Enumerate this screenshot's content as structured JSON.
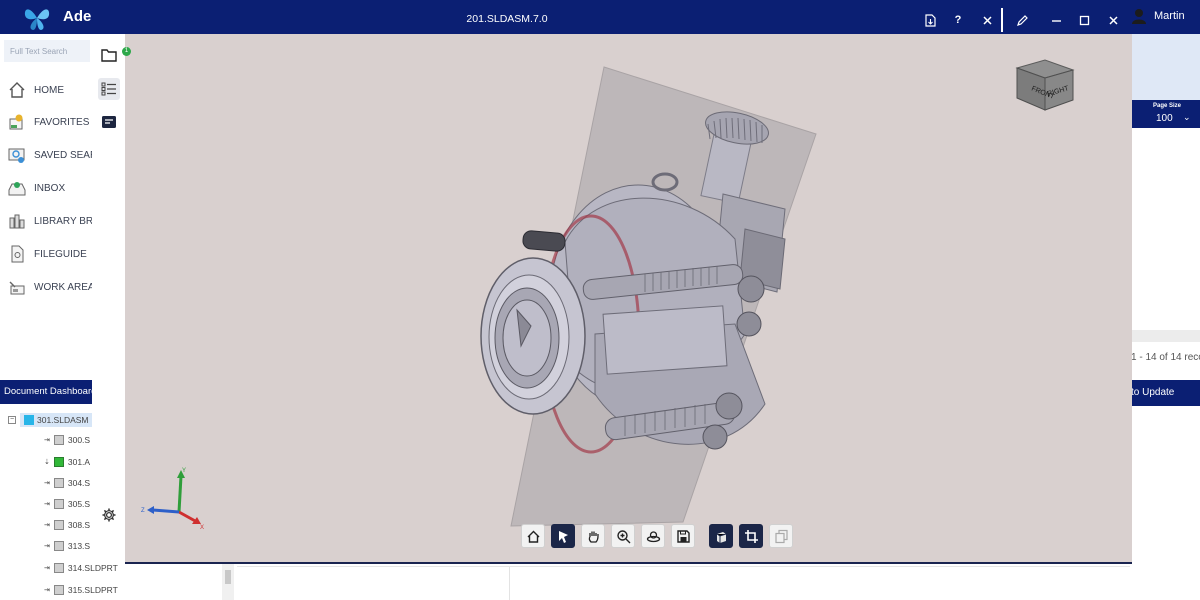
{
  "app": {
    "brand_text": "Ade",
    "user_name": "Martin",
    "search_placeholder": "Full Text Search",
    "nav": [
      {
        "label": "HOME",
        "icon": "home-icon"
      },
      {
        "label": "FAVORITES",
        "icon": "favorites-icon"
      },
      {
        "label": "SAVED SEAR",
        "icon": "saved-search-icon"
      },
      {
        "label": "INBOX",
        "icon": "inbox-icon"
      },
      {
        "label": "LIBRARY BR",
        "icon": "library-icon"
      },
      {
        "label": "FILEGUIDE",
        "icon": "fileguide-icon"
      },
      {
        "label": "WORK AREA",
        "icon": "work-area-icon"
      }
    ],
    "dashboard_label": "Document Dashboard",
    "tree": {
      "root": "301.SLDASM",
      "children": [
        "300.S",
        "301.A",
        "304.S",
        "305.S",
        "308.S",
        "313.S",
        "314.SLDPRT",
        "315.SLDPRT"
      ]
    },
    "right": {
      "page_size_label": "Page Size",
      "page_size_value": "100",
      "records_text": "1 - 14 of 14 reco",
      "update_text": "to Update"
    }
  },
  "viewer": {
    "title": "201.SLDASM.7.0",
    "badge_count": "1",
    "viewcube": {
      "front": "FRONT",
      "right": "RIGHT"
    },
    "axes": {
      "x": "X",
      "y": "Y",
      "z": "Z"
    },
    "toolbar": [
      {
        "name": "home-view",
        "icon": "home-icon"
      },
      {
        "name": "select",
        "icon": "cursor-icon"
      },
      {
        "name": "pan",
        "icon": "hand-icon"
      },
      {
        "name": "zoom",
        "icon": "zoom-icon"
      },
      {
        "name": "rotate",
        "icon": "rotate-icon"
      },
      {
        "name": "save",
        "icon": "save-icon"
      },
      {
        "name": "shading",
        "icon": "cube-icon"
      },
      {
        "name": "section",
        "icon": "crop-icon"
      },
      {
        "name": "explode",
        "icon": "layers-icon"
      }
    ]
  },
  "colors": {
    "brand_navy": "#0b1f73",
    "viewer_bg": "#d9d0cf",
    "plane": "#bdb7b9",
    "part": "#b8b7c4"
  }
}
